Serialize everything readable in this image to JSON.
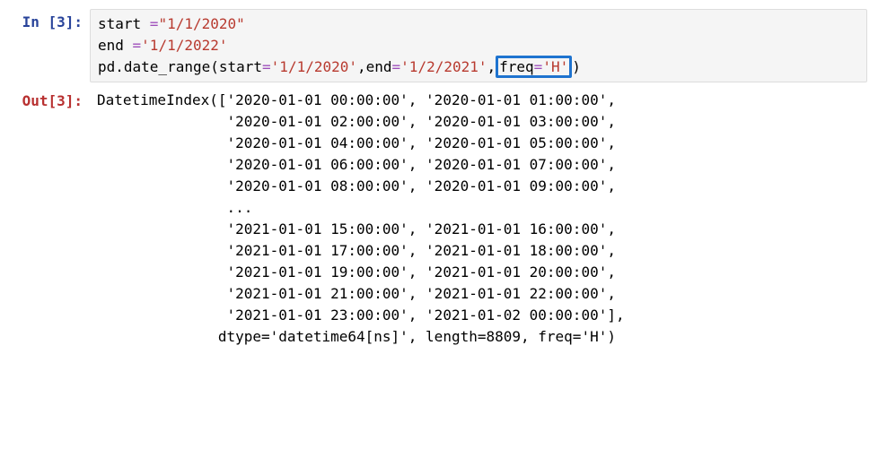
{
  "in_prompt": "In [3]:",
  "out_prompt": "Out[3]:",
  "code": {
    "l1a": "start ",
    "l1op": "=",
    "l1b": "\"1/1/2020\"",
    "l2a": "end ",
    "l2op": "=",
    "l2b": "'1/1/2022'",
    "l3a": "pd.date_range(start",
    "l3op1": "=",
    "l3s1": "'1/1/2020'",
    "l3c1": ",end",
    "l3op2": "=",
    "l3s2": "'1/2/2021'",
    "l3c2": ",",
    "l3h_a": "freq",
    "l3h_op": "=",
    "l3h_s": "'H'",
    "l3end": ")"
  },
  "output_text": "DatetimeIndex(['2020-01-01 00:00:00', '2020-01-01 01:00:00',\n               '2020-01-01 02:00:00', '2020-01-01 03:00:00',\n               '2020-01-01 04:00:00', '2020-01-01 05:00:00',\n               '2020-01-01 06:00:00', '2020-01-01 07:00:00',\n               '2020-01-01 08:00:00', '2020-01-01 09:00:00',\n               ...\n               '2021-01-01 15:00:00', '2021-01-01 16:00:00',\n               '2021-01-01 17:00:00', '2021-01-01 18:00:00',\n               '2021-01-01 19:00:00', '2021-01-01 20:00:00',\n               '2021-01-01 21:00:00', '2021-01-01 22:00:00',\n               '2021-01-01 23:00:00', '2021-01-02 00:00:00'],\n              dtype='datetime64[ns]', length=8809, freq='H')"
}
